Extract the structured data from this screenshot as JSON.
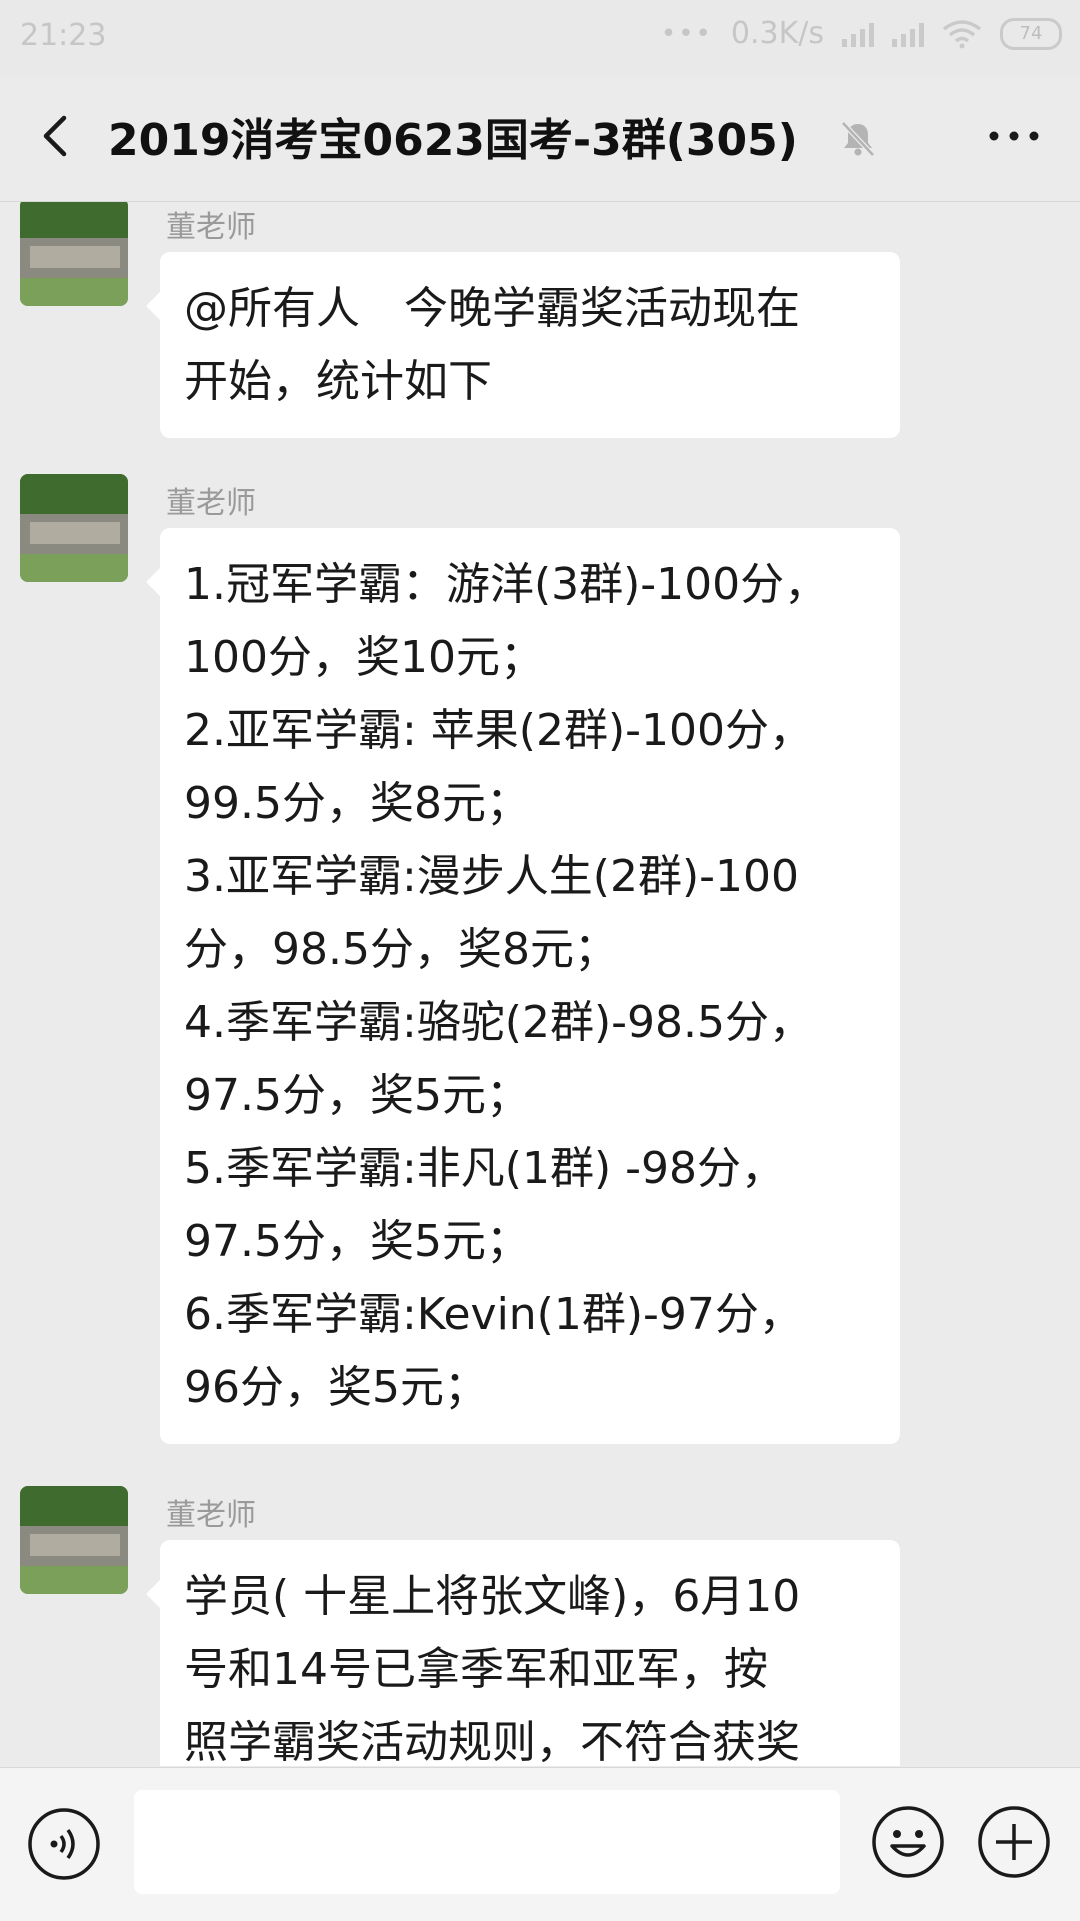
{
  "status_bar": {
    "time": "21:23",
    "dots": "•••",
    "network_speed": "0.3K/s",
    "battery": "74"
  },
  "header": {
    "title": "2019消考宝0623国考-3群(305)",
    "icons": [
      "back-icon",
      "mute-bell-icon",
      "more-icon"
    ]
  },
  "messages": [
    {
      "sender": "董老师",
      "lines": [
        "@所有人　今晚学霸奖活动现在",
        "开始，统计如下"
      ]
    },
    {
      "sender": "董老师",
      "lines": [
        "1.冠军学霸：游洋(3群)-100分，",
        "100分，奖10元；",
        "2.亚军学霸: 苹果(2群)-100分，",
        "99.5分，奖8元；",
        "3.亚军学霸:漫步人生(2群)-100",
        "分，98.5分，奖8元；",
        "4.季军学霸:骆驼(2群)-98.5分，",
        "97.5分，奖5元；",
        "5.季军学霸:非凡(1群) -98分，",
        "97.5分，奖5元；",
        "6.季军学霸:Kevin(1群)-97分，",
        "96分，奖5元；"
      ]
    },
    {
      "sender": "董老师",
      "lines": [
        "学员( 十星上将张文峰)，6月10",
        "号和14号已拿季军和亚军，按",
        "照学霸奖活动规则，不符合获奖"
      ]
    }
  ],
  "input_bar": {
    "placeholder": "",
    "icons": [
      "voice-icon",
      "emoji-icon",
      "plus-icon"
    ]
  }
}
